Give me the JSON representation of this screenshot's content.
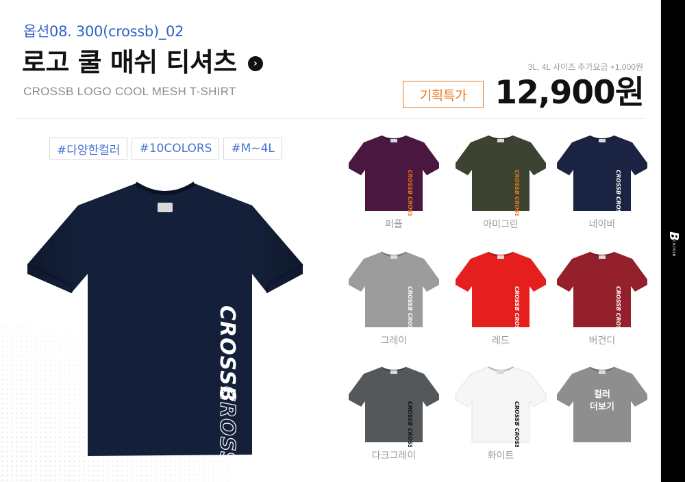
{
  "product": {
    "option_code": "옵션08. 300(crossb)_02",
    "title": "로고 쿨 매쉬 티셔츠",
    "arrow_glyph": "›",
    "subtitle": "CROSSB LOGO COOL MESH T-SHIRT",
    "extra_fee": "3L, 4L 사이즈 추가요금 +1,000원",
    "badge": "기획특가",
    "price": "12,900원"
  },
  "tags": [
    "#다양한컬러",
    "#10COLORS",
    "#M~4L"
  ],
  "main_shirt": {
    "color": "#14203a",
    "logo_text": "CROSSB",
    "logo_text_mirror": "CROSSB"
  },
  "colors": [
    {
      "name": "퍼플",
      "hex": "#4a1740",
      "logo": "#e8781e"
    },
    {
      "name": "아미그린",
      "hex": "#3c4330",
      "logo": "#e8781e"
    },
    {
      "name": "네이비",
      "hex": "#1a2342",
      "logo": "#ffffff"
    },
    {
      "name": "그레이",
      "hex": "#9c9c9c",
      "logo": "#ffffff"
    },
    {
      "name": "레드",
      "hex": "#e51e1e",
      "logo": "#ffffff"
    },
    {
      "name": "버건디",
      "hex": "#94202c",
      "logo": "#ffffff"
    },
    {
      "name": "다크그레이",
      "hex": "#55585b",
      "logo": "#111111"
    },
    {
      "name": "화이트",
      "hex": "#f6f6f6",
      "logo": "#111111"
    }
  ],
  "more_colors": {
    "line1": "컬러",
    "line2": "더보기",
    "hex": "#8e8e8e",
    "logo": "#ffffff"
  },
  "brand_strip": {
    "mark": "B",
    "text": "CROSSB"
  },
  "theme": {
    "accent_blue": "#2f63c9",
    "accent_orange": "#e8781e"
  }
}
